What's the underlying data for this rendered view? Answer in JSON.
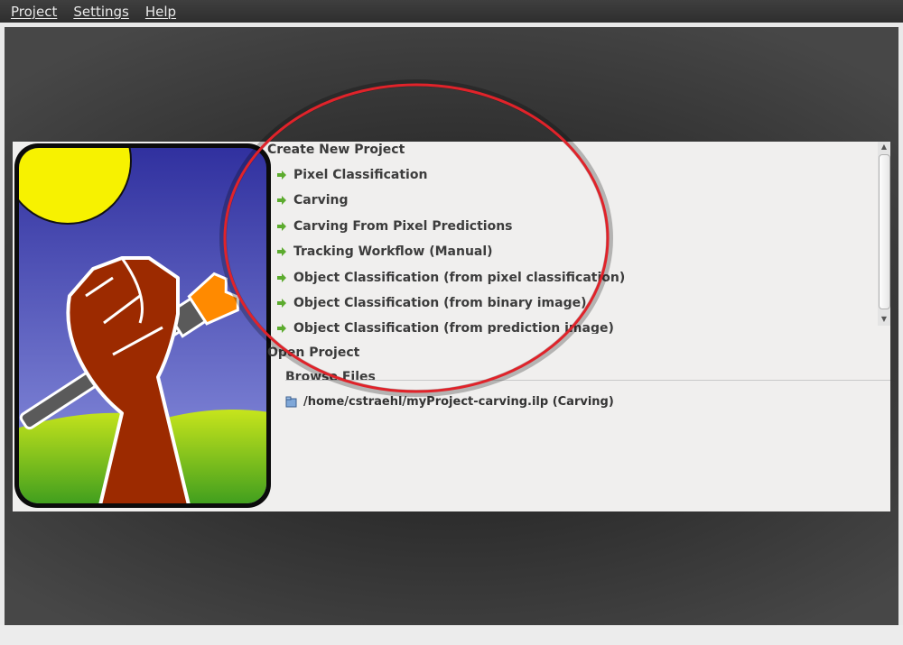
{
  "menubar": {
    "items": [
      {
        "label": "Project"
      },
      {
        "label": "Settings"
      },
      {
        "label": "Help"
      }
    ]
  },
  "startup": {
    "create_header": "Create New Project",
    "workflows": [
      {
        "label": "Pixel Classification"
      },
      {
        "label": "Carving"
      },
      {
        "label": "Carving From Pixel Predictions"
      },
      {
        "label": "Tracking Workflow (Manual)"
      },
      {
        "label": "Object Classification (from pixel classification)"
      },
      {
        "label": "Object Classification (from binary image)"
      },
      {
        "label": "Object Classification (from prediction image)"
      }
    ],
    "open_header": "Open Project",
    "browse_label": "Browse Files",
    "recent": [
      {
        "label": "/home/cstraehl/myProject-carving.ilp (Carving)"
      }
    ]
  },
  "icons": {
    "workflow_arrow": "green-arrow-icon",
    "file": "project-file-icon"
  },
  "colors": {
    "menubar": "#333333",
    "lens_border": "#e0232a",
    "arrow": "#5cab2e",
    "panel": "#f0efee"
  }
}
